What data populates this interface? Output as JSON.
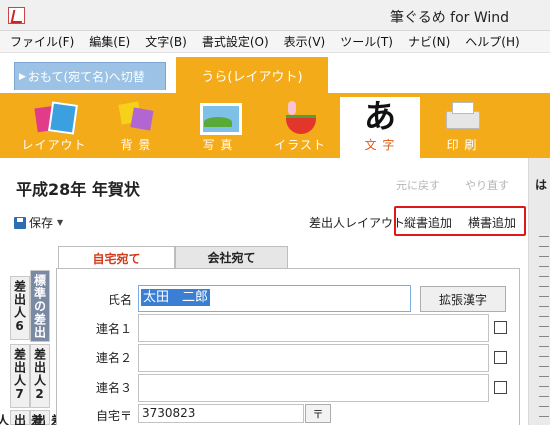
{
  "window": {
    "title": "筆ぐるめ for Wind"
  },
  "menu": [
    "ファイル(F)",
    "編集(E)",
    "文字(B)",
    "書式設定(O)",
    "表示(V)",
    "ツール(T)",
    "ナビ(N)",
    "ヘルプ(H)"
  ],
  "top_tabs": {
    "omote": "おもて(宛て名)へ切替",
    "omote_marker": "▶",
    "ura": "うら(レイアウト)"
  },
  "ribbon": [
    {
      "label": "レイアウト",
      "icon": "layout-icon"
    },
    {
      "label": "背 景",
      "icon": "background-icon"
    },
    {
      "label": "写 真",
      "icon": "photo-icon"
    },
    {
      "label": "イラスト",
      "icon": "illustration-icon"
    },
    {
      "label": "文 字",
      "icon": "text-icon",
      "glyph": "あ",
      "active": true
    },
    {
      "label": "印 刷",
      "icon": "printer-icon"
    }
  ],
  "panel": {
    "title": "平成28年 年賀状",
    "undo": "元に戻す",
    "redo": "やり直す",
    "save": "保存",
    "save_caret": "▼",
    "sender_layout": "差出人レイアウト",
    "add_vertical": "縦書追加",
    "add_horizontal": "横書追加",
    "right_strip_text": "は"
  },
  "subtabs": {
    "home": "自宅宛て",
    "company": "会社宛て"
  },
  "side_tabs": [
    "標準の差出",
    "差出人6",
    "差出人2",
    "差出人7",
    "差出人",
    "差出人"
  ],
  "form": {
    "name_label": "氏名",
    "name_value": "太田　二郎",
    "ext_kanji": "拡張漢字",
    "joint1_label": "連名１",
    "joint2_label": "連名２",
    "joint3_label": "連名３",
    "zip_label": "自宅〒",
    "zip_value": "3730823",
    "zip_button": "〒"
  },
  "colors": {
    "accent_orange": "#f4ab1a",
    "highlight_red": "#e01818",
    "omote_blue": "#9cc3e6"
  }
}
